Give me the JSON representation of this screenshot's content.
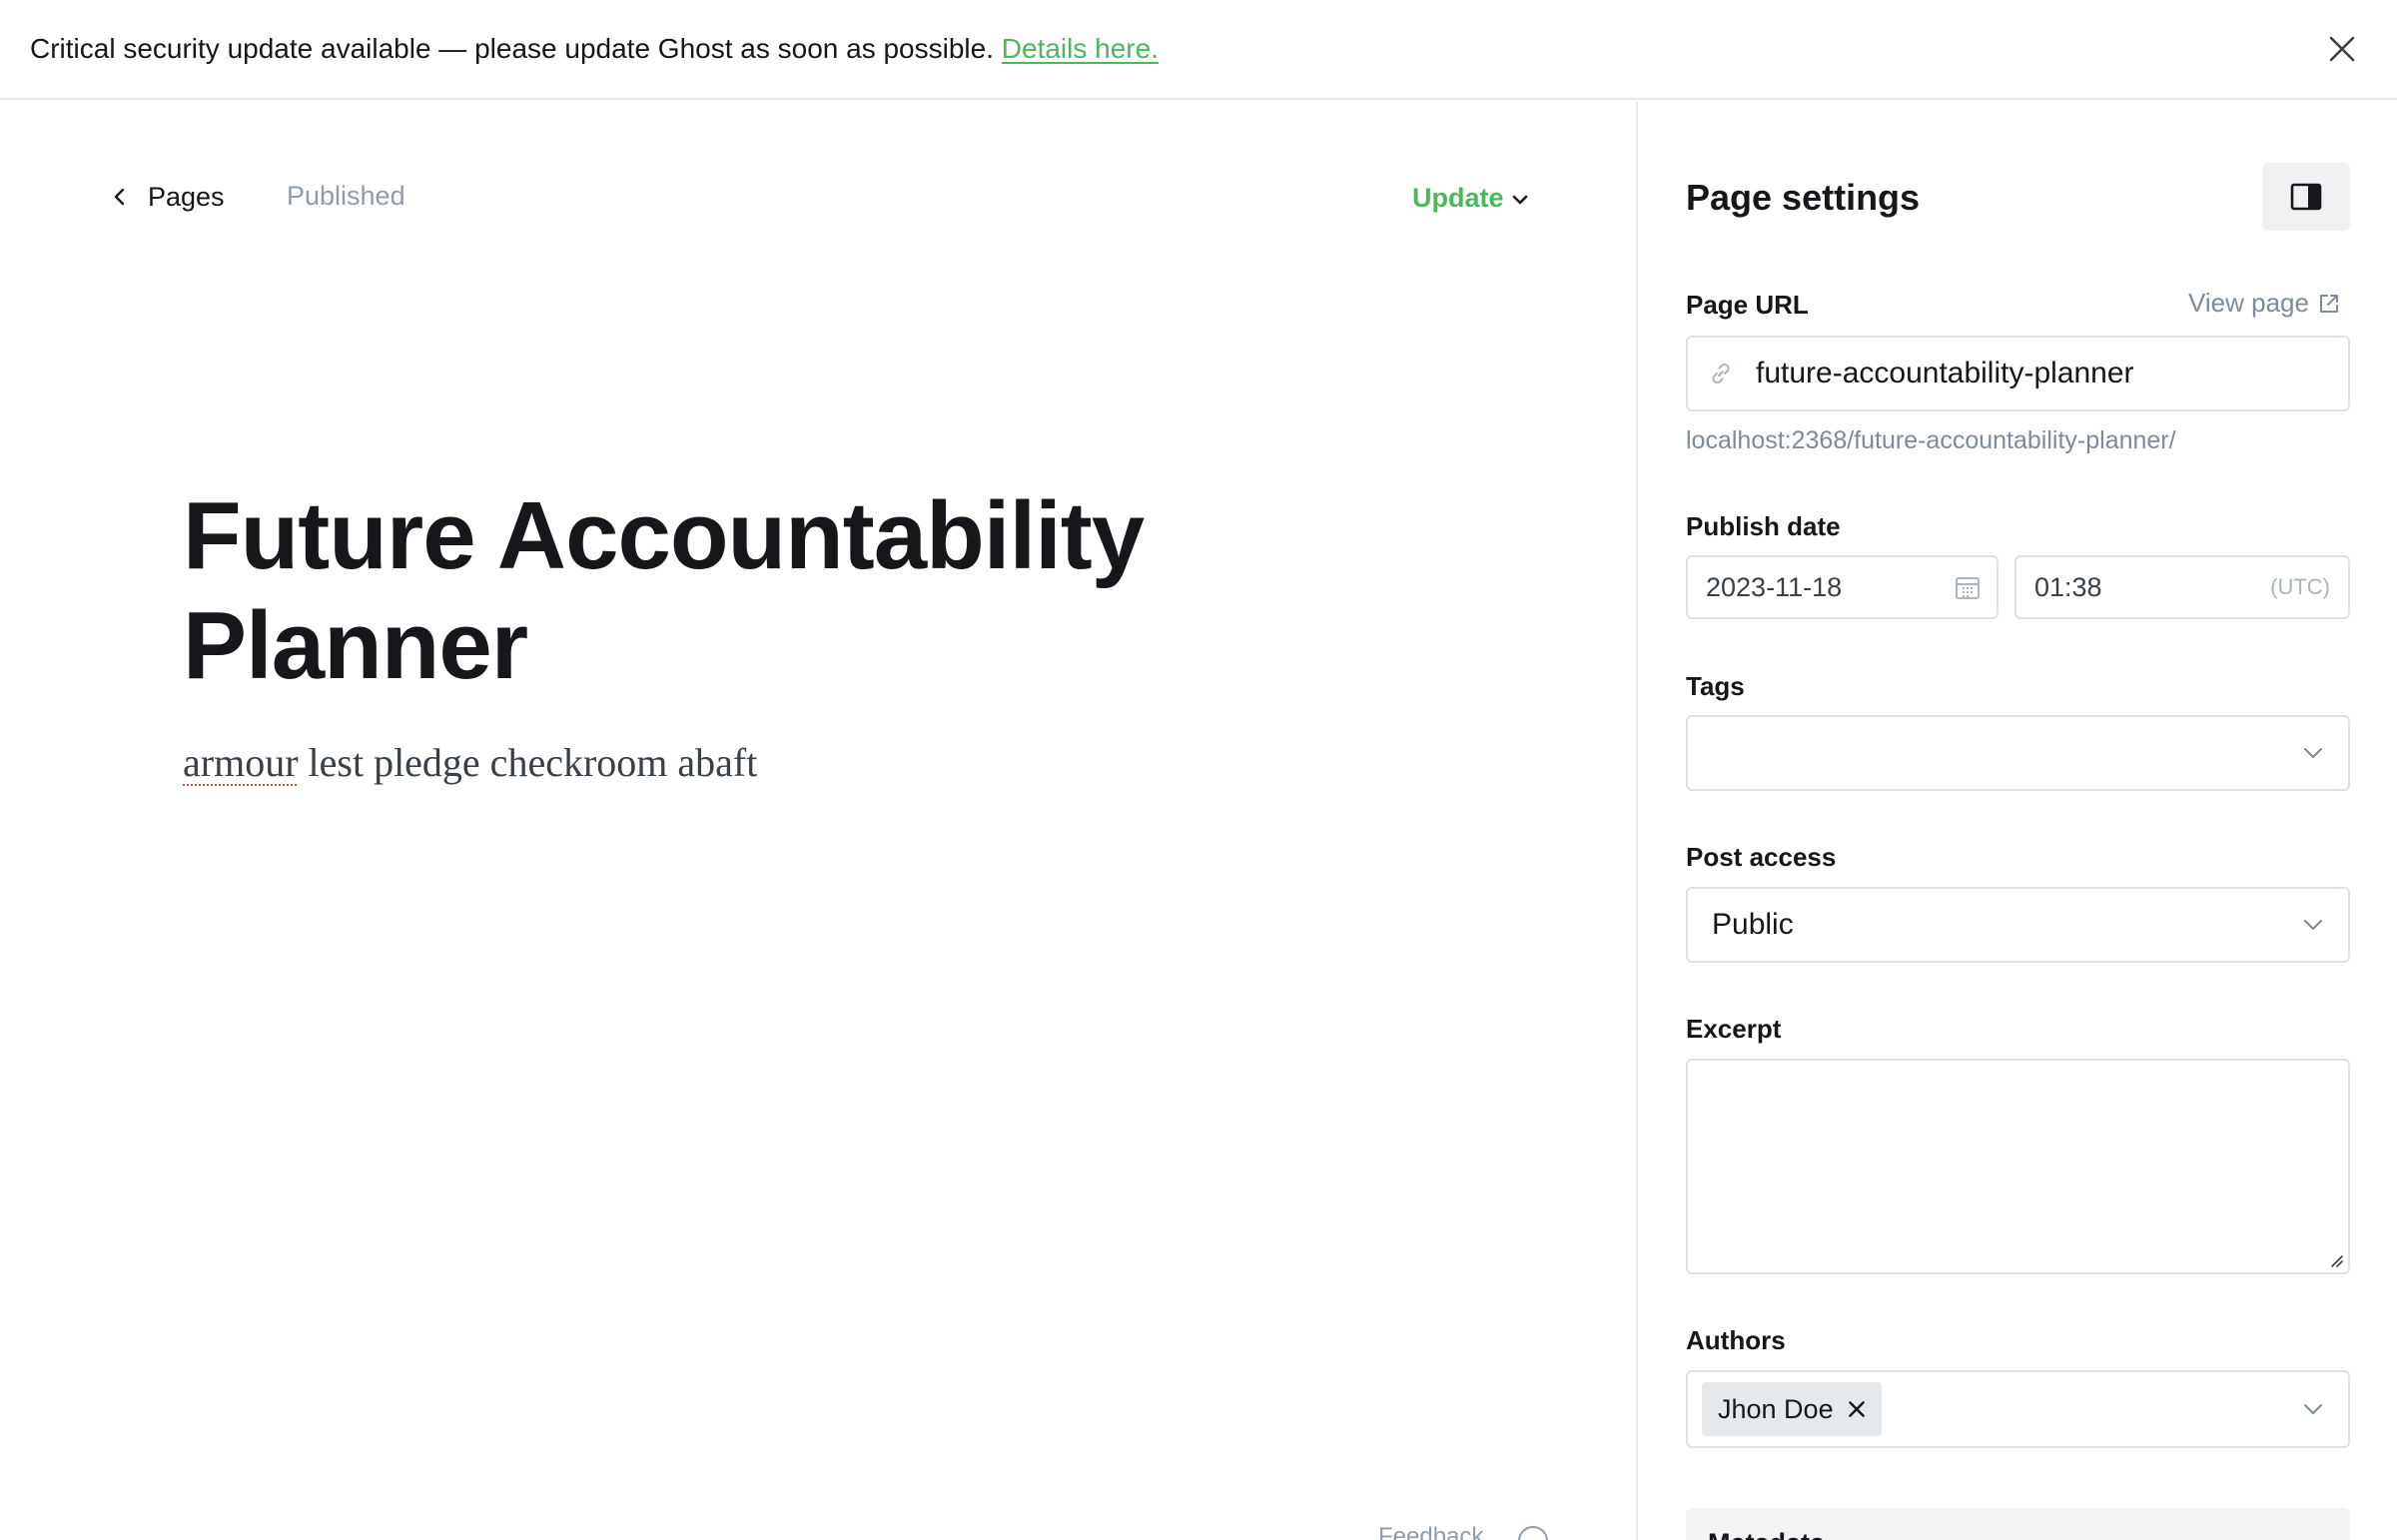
{
  "banner": {
    "message": "Critical security update available — please update Ghost as soon as possible.",
    "link_label": "Details here."
  },
  "header": {
    "back_label": "Pages",
    "status": "Published",
    "update_label": "Update"
  },
  "post": {
    "title": "Future Accountability Planner",
    "body_misspelled": "armour",
    "body_rest": " lest pledge checkroom abaft"
  },
  "footer": {
    "faded_text": "Feedback"
  },
  "settings": {
    "title": "Page settings",
    "page_url": {
      "label": "Page URL",
      "view_page": "View page",
      "value": "future-accountability-planner",
      "hint": "localhost:2368/future-accountability-planner/"
    },
    "publish_date": {
      "label": "Publish date",
      "date": "2023-11-18",
      "time": "01:38",
      "timezone": "(UTC)"
    },
    "tags": {
      "label": "Tags",
      "value": ""
    },
    "post_access": {
      "label": "Post access",
      "value": "Public"
    },
    "excerpt": {
      "label": "Excerpt",
      "value": ""
    },
    "authors": {
      "label": "Authors",
      "items": [
        "Jhon Doe"
      ]
    },
    "next_section": "Metadata"
  },
  "colors": {
    "accent_green": "#4cb85c",
    "muted": "#8e9cac",
    "border": "#dde1e5"
  }
}
